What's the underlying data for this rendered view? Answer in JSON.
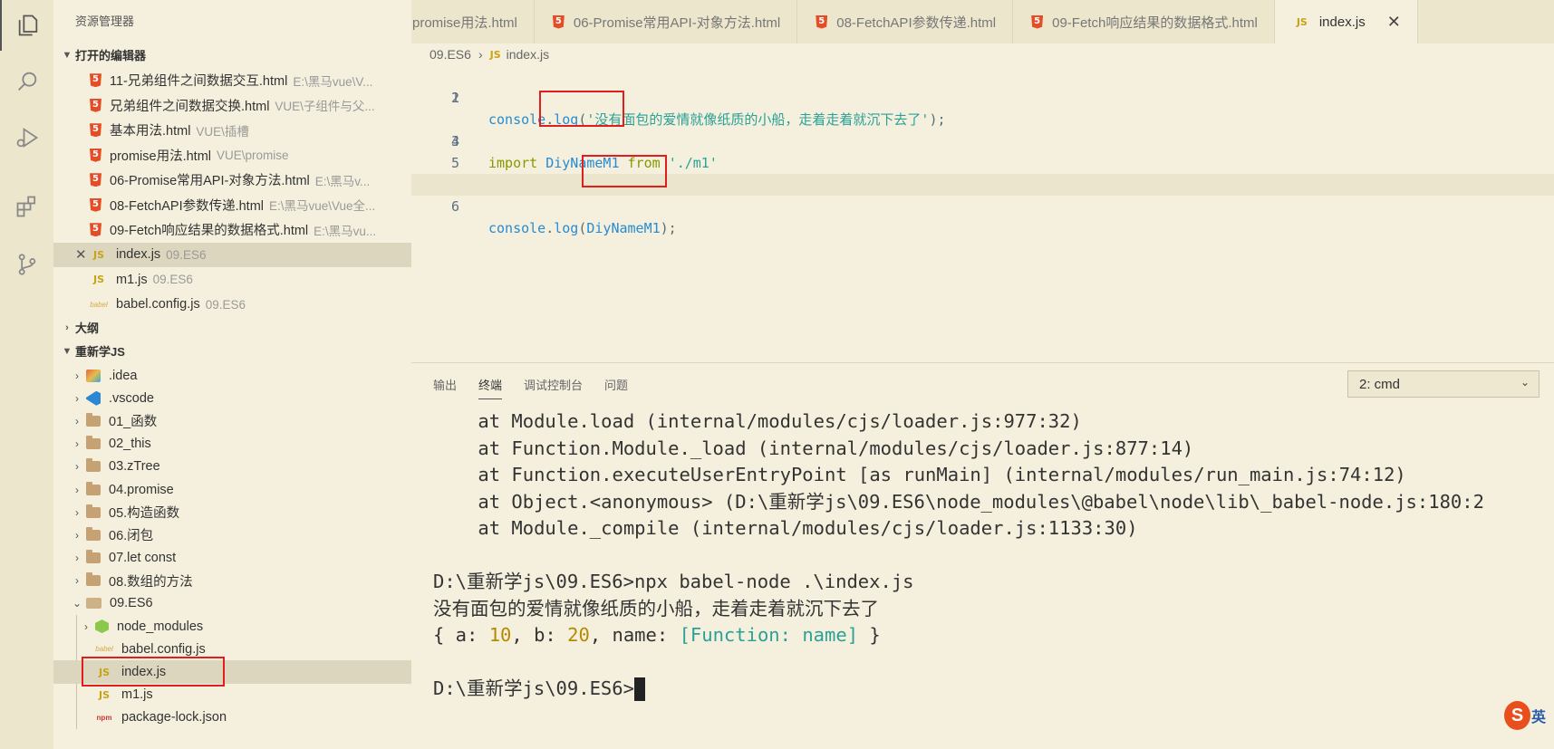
{
  "activity_bar": {
    "items": [
      {
        "name": "explorer-icon"
      },
      {
        "name": "search-icon"
      },
      {
        "name": "run-debug-icon"
      },
      {
        "name": "extensions-icon"
      },
      {
        "name": "source-control-icon"
      }
    ]
  },
  "sidebar": {
    "title": "资源管理器",
    "open_editors": {
      "header": "打开的编辑器",
      "items": [
        {
          "name": "11-兄弟组件之间数据交互.html",
          "path": "E:\\黑马vue\\V...",
          "icon": "html-icon"
        },
        {
          "name": "兄弟组件之间数据交换.html",
          "path": "VUE\\子组件与父...",
          "icon": "html-icon"
        },
        {
          "name": "基本用法.html",
          "path": "VUE\\插槽",
          "icon": "html-icon"
        },
        {
          "name": "promise用法.html",
          "path": "VUE\\promise",
          "icon": "html-icon"
        },
        {
          "name": "06-Promise常用API-对象方法.html",
          "path": "E:\\黑马v...",
          "icon": "html-icon"
        },
        {
          "name": "08-FetchAPI参数传递.html",
          "path": "E:\\黑马vue\\Vue全...",
          "icon": "html-icon"
        },
        {
          "name": "09-Fetch响应结果的数据格式.html",
          "path": "E:\\黑马vu...",
          "icon": "html-icon"
        },
        {
          "name": "index.js",
          "path": "09.ES6",
          "icon": "js-icon",
          "close": "✕",
          "selected": true
        },
        {
          "name": "m1.js",
          "path": "09.ES6",
          "icon": "js-icon"
        },
        {
          "name": "babel.config.js",
          "path": "09.ES6",
          "icon": "babel-icon"
        }
      ]
    },
    "outline": {
      "header": "大纲"
    },
    "workspace": {
      "header": "重新学JS",
      "folders": [
        ".idea",
        ".vscode",
        "01_函数",
        "02_this",
        "03.zTree",
        "04.promise",
        "05.构造函数",
        "06.闭包",
        "07.let const",
        "08.数组的方法"
      ],
      "open_folder": "09.ES6",
      "children": [
        {
          "name": "node_modules",
          "icon": "node-modules-icon"
        },
        {
          "name": "babel.config.js",
          "icon": "babel-icon"
        },
        {
          "name": "index.js",
          "icon": "js-icon",
          "selected": true
        },
        {
          "name": "m1.js",
          "icon": "js-icon"
        },
        {
          "name": "package-lock.json",
          "icon": "npm-icon"
        }
      ]
    }
  },
  "tabs": [
    {
      "label": "promise用法.html",
      "icon": "html-icon"
    },
    {
      "label": "06-Promise常用API-对象方法.html",
      "icon": "html-icon"
    },
    {
      "label": "08-FetchAPI参数传递.html",
      "icon": "html-icon"
    },
    {
      "label": "09-Fetch响应结果的数据格式.html",
      "icon": "html-icon"
    },
    {
      "label": "index.js",
      "icon": "js-icon",
      "active": true,
      "close": "✕"
    }
  ],
  "breadcrumb": {
    "folder": "09.ES6",
    "sep": "›",
    "js_badge": "JS",
    "file": "index.js"
  },
  "code": {
    "lines": [
      {
        "n": "1",
        "obj": "console",
        "dot": ".",
        "fn": "log",
        "open": "(",
        "str": "'没有面包的爱情就像纸质的小船，走着走着就沉下去了'",
        "close": ");"
      },
      {
        "n": "2"
      },
      {
        "n": "3",
        "kw1": "import",
        "id": "DiyNameM1",
        "kw2": "from",
        "str": "'./m1'"
      },
      {
        "n": "4"
      },
      {
        "n": "5"
      },
      {
        "n": "6",
        "obj": "console",
        "dot": ".",
        "fn": "log",
        "open": "(",
        "arg": "DiyNameM1",
        "close": ");"
      }
    ]
  },
  "panel": {
    "tabs": [
      "输出",
      "终端",
      "调试控制台",
      "问题"
    ],
    "active_tab": "终端",
    "terminal_select": "2: cmd",
    "terminal": {
      "stack": [
        "    at Module.load (internal/modules/cjs/loader.js:977:32)",
        "    at Function.Module._load (internal/modules/cjs/loader.js:877:14)",
        "    at Function.executeUserEntryPoint [as runMain] (internal/modules/run_main.js:74:12)",
        "    at Object.<anonymous> (D:\\重新学js\\09.ES6\\node_modules\\@babel\\node\\lib\\_babel-node.js:180:2",
        "    at Module._compile (internal/modules/cjs/loader.js:1133:30)"
      ],
      "command": "D:\\重新学js\\09.ES6>npx babel-node .\\index.js",
      "output_text": "没有面包的爱情就像纸质的小船，走着走着就沉下去了",
      "obj": {
        "open": "{ a: ",
        "a": "10",
        "mid1": ", b: ",
        "b": "20",
        "mid2": ", name: ",
        "fn": "[Function: name]",
        "end": " }"
      },
      "prompt": "D:\\重新学js\\09.ES6>"
    }
  },
  "ime": {
    "logo": "S",
    "label": "英"
  },
  "colors": {
    "highlight_box": "#e01e1e",
    "background": "#f5f0dd"
  }
}
